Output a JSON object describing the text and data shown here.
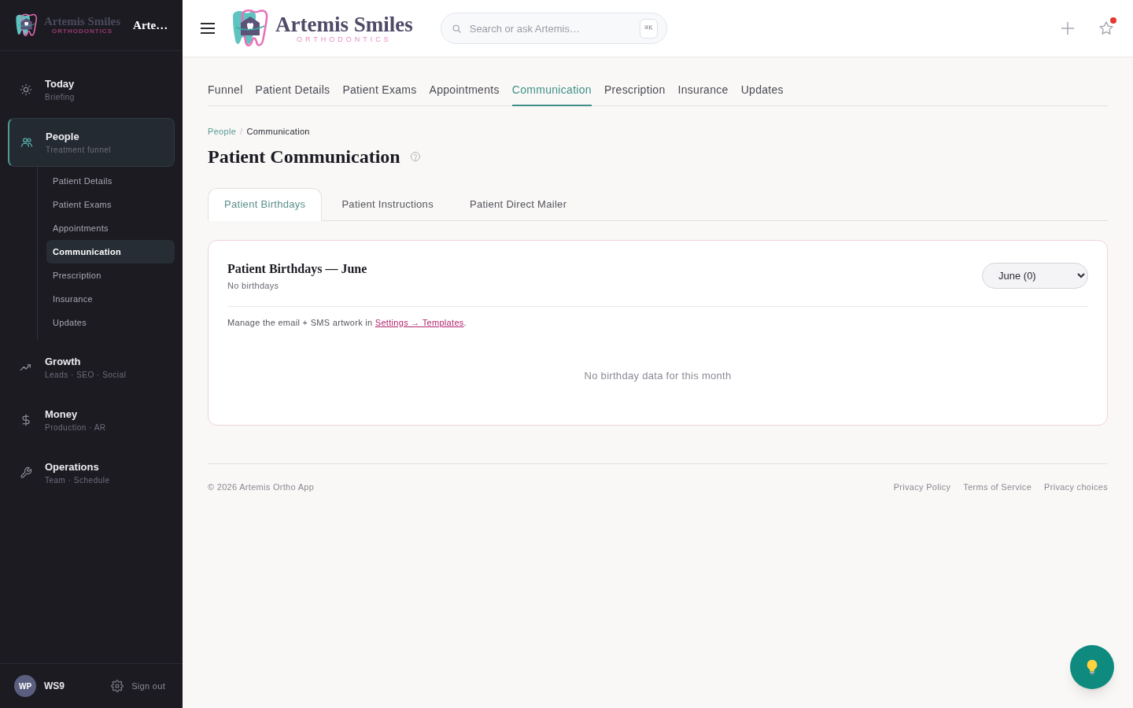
{
  "sidebar": {
    "logo": {
      "name": "Artemis Smiles",
      "tagline": "ORTHODONTICS"
    },
    "brand": "Arte…",
    "nav": [
      {
        "label": "Today",
        "sublabel": "Briefing",
        "selected": false
      },
      {
        "label": "People",
        "sublabel": "Treatment funnel",
        "selected": true,
        "children": [
          {
            "label": "Patient Details",
            "selected": false
          },
          {
            "label": "Patient Exams",
            "selected": false
          },
          {
            "label": "Appointments",
            "selected": false
          },
          {
            "label": "Communication",
            "selected": true
          },
          {
            "label": "Prescription",
            "selected": false
          },
          {
            "label": "Insurance",
            "selected": false
          },
          {
            "label": "Updates",
            "selected": false
          }
        ]
      },
      {
        "label": "Growth",
        "sublabel": "Leads · SEO · Social",
        "selected": false
      },
      {
        "label": "Money",
        "sublabel": "Production · AR",
        "selected": false
      },
      {
        "label": "Operations",
        "sublabel": "Team · Schedule",
        "selected": false
      }
    ],
    "user": {
      "initials": "WP",
      "name": "WS9",
      "sign_out": "Sign out"
    }
  },
  "header": {
    "logo": {
      "name": "Artemis Smiles",
      "tagline": "ORTHODONTICS"
    },
    "search": {
      "placeholder": "Search or ask Artemis…",
      "shortcut": "⌘K"
    },
    "favorites_alert": true
  },
  "tabs": [
    {
      "label": "Funnel",
      "selected": false
    },
    {
      "label": "Patient Details",
      "selected": false
    },
    {
      "label": "Patient Exams",
      "selected": false
    },
    {
      "label": "Appointments",
      "selected": false
    },
    {
      "label": "Communication",
      "selected": true
    },
    {
      "label": "Prescription",
      "selected": false
    },
    {
      "label": "Insurance",
      "selected": false
    },
    {
      "label": "Updates",
      "selected": false
    }
  ],
  "breadcrumb": {
    "items": [
      "People",
      "Communication"
    ],
    "separator": "/"
  },
  "page_title": "Patient Communication",
  "subtabs": [
    {
      "label": "Patient Birthdays",
      "selected": true
    },
    {
      "label": "Patient Instructions",
      "selected": false
    },
    {
      "label": "Patient Direct Mailer",
      "selected": false
    }
  ],
  "card": {
    "title": "Patient Birthdays — June",
    "subtitle": "No birthdays",
    "month_select": {
      "value": "June (0)"
    },
    "note": {
      "before": "Manage the email + SMS artwork in ",
      "link": "Settings → Templates",
      "after": "."
    },
    "empty_message": "No birthday data for this month"
  },
  "footer": {
    "copyright": "© 2026 Artemis Ortho App",
    "links": [
      "Privacy Policy",
      "Terms of Service",
      "Privacy choices"
    ]
  }
}
